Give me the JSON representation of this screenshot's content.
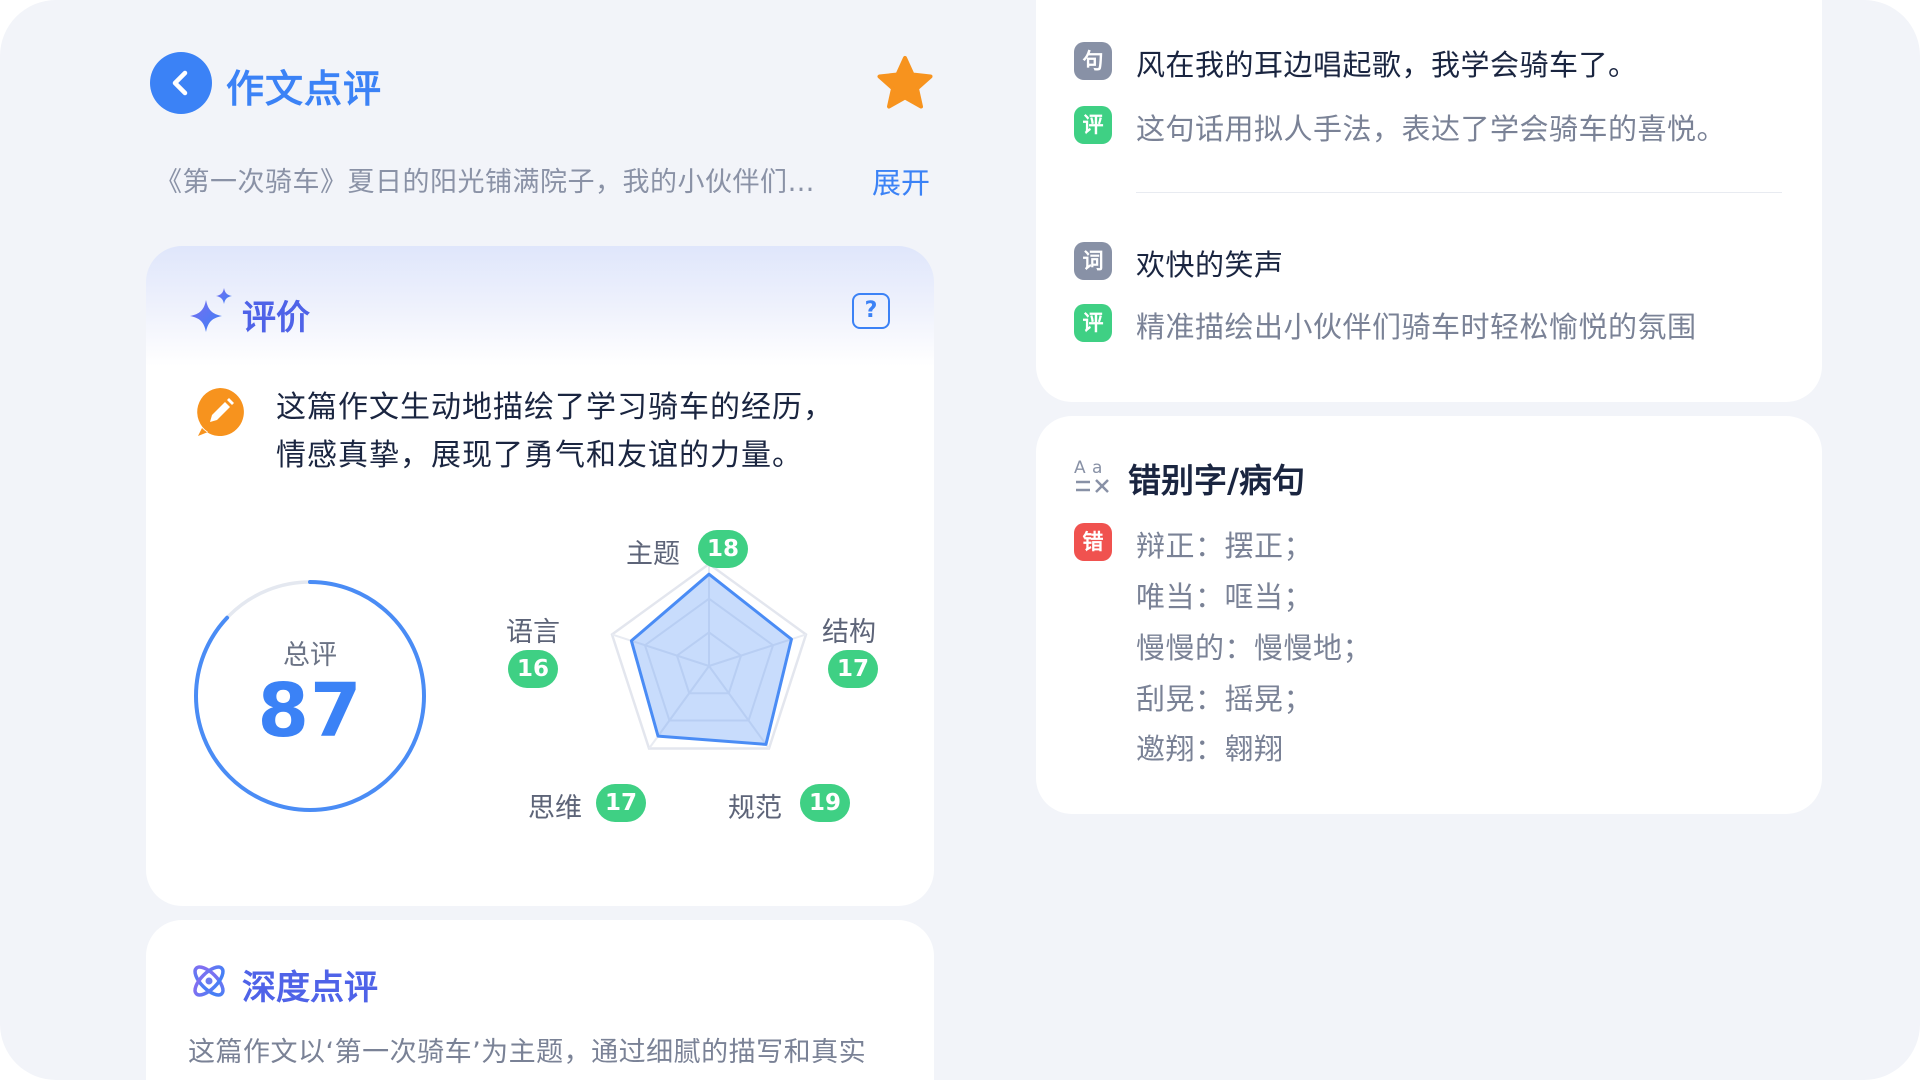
{
  "header": {
    "title": "作文点评",
    "back_icon": "chevron-left-icon",
    "star_icon": "star-icon",
    "accent": "#3b82f6",
    "star_color": "#f7931e"
  },
  "essay": {
    "excerpt": "《第一次骑车》夏日的阳光铺满院子，我的小伙伴们…",
    "expand_label": "展开"
  },
  "evaluation": {
    "title": "评价",
    "help_label": "?",
    "summary_line1": "这篇作文生动地描绘了学习骑车的经历，",
    "summary_line2": "情感真挚，展现了勇气和友谊的力量。",
    "total_label": "总评",
    "total_score": "87",
    "total_max": 100,
    "dimensions": [
      {
        "name": "主题",
        "score": 18
      },
      {
        "name": "结构",
        "score": 17
      },
      {
        "name": "规范",
        "score": 19
      },
      {
        "name": "思维",
        "score": 17
      },
      {
        "name": "语言",
        "score": 16
      }
    ],
    "dimension_max": 20
  },
  "deep_review": {
    "title": "深度点评",
    "text": "这篇作文以‘第一次骑车’为主题，通过细腻的描写和真实"
  },
  "highlights": {
    "sentence_tag": "句",
    "sentence": "风在我的耳边唱起歌，我学会骑车了。",
    "sentence_comment_tag": "评",
    "sentence_comment": "这句话用拟人手法，表达了学会骑车的喜悦。",
    "word_tag": "词",
    "word": "欢快的笑声",
    "word_comment_tag": "评",
    "word_comment": "精准描绘出小伙伴们骑车时轻松愉悦的氛围"
  },
  "errors": {
    "title": "错别字/病句",
    "tag": "错",
    "items": [
      "辩正：摆正；",
      "唯当：哐当；",
      "慢慢的：慢慢地；",
      "刮晃：摇晃；",
      "邀翔：翱翔"
    ]
  }
}
